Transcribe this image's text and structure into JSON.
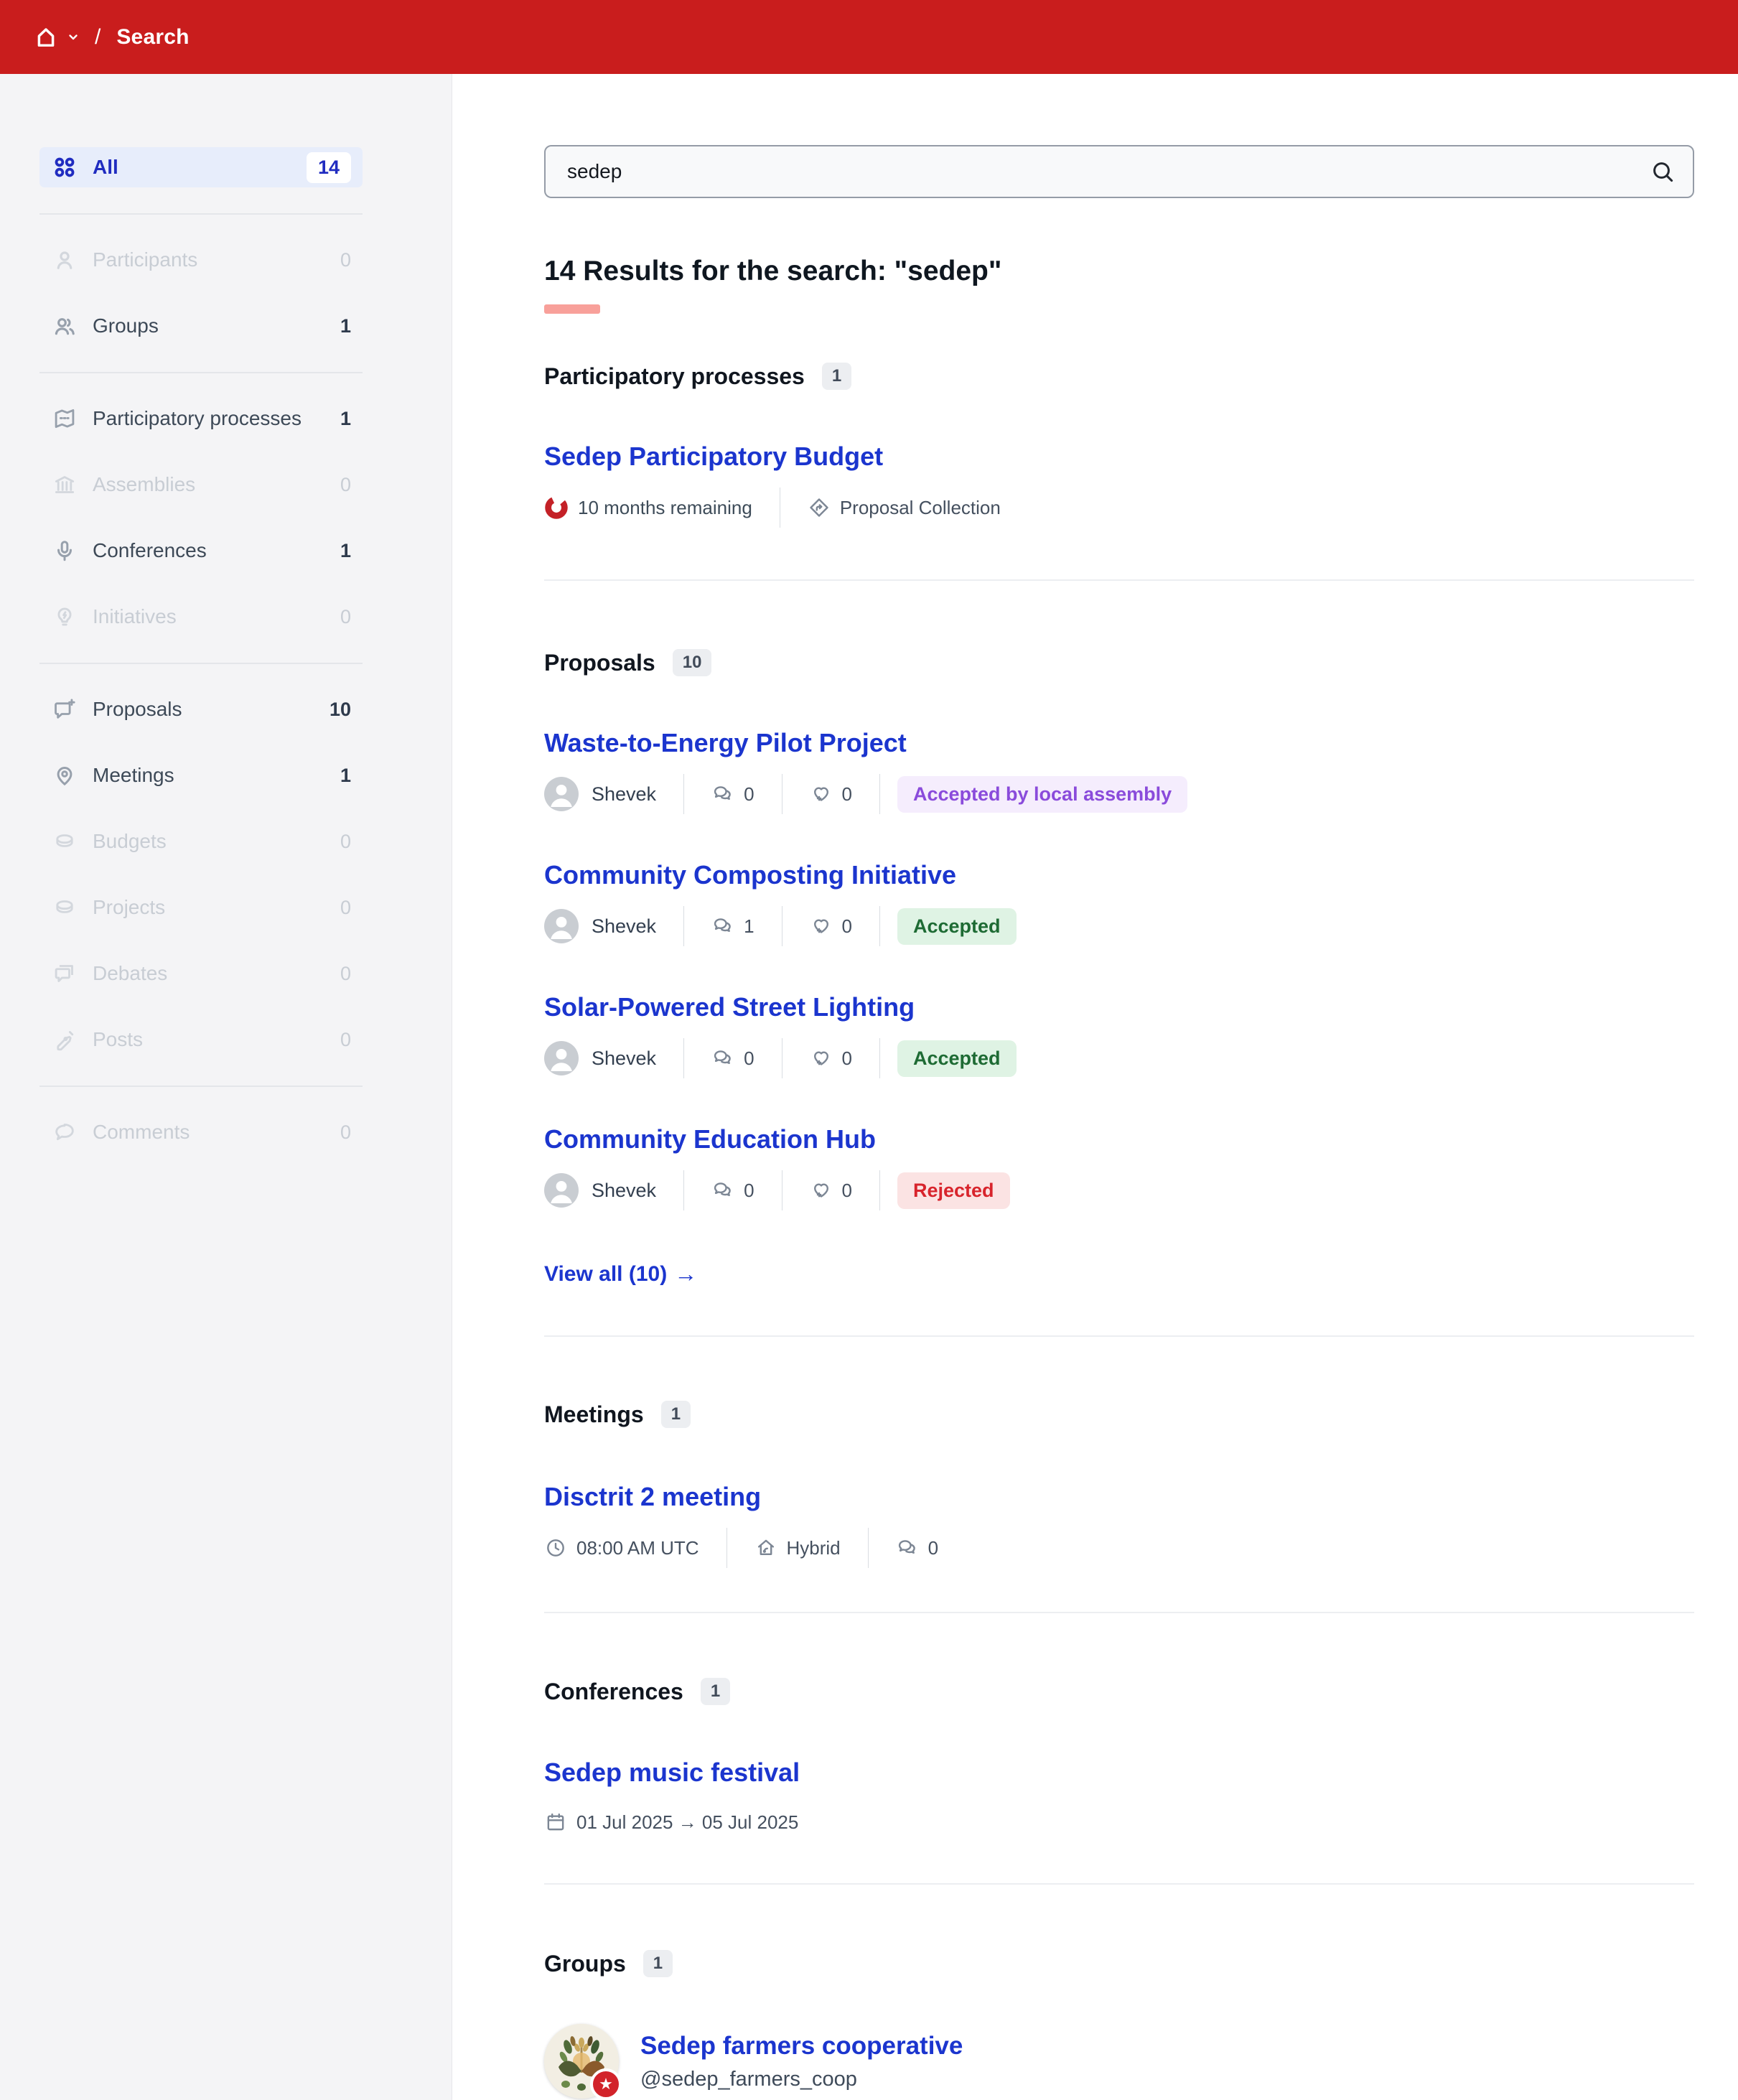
{
  "header": {
    "title": "Search",
    "separator": "/"
  },
  "search": {
    "value": "sedep"
  },
  "results_heading": "14 Results for the search: \"sedep\"",
  "sidebar": {
    "items": [
      {
        "label": "All",
        "count": "14"
      },
      {
        "label": "Participants",
        "count": "0"
      },
      {
        "label": "Groups",
        "count": "1"
      },
      {
        "label": "Participatory processes",
        "count": "1"
      },
      {
        "label": "Assemblies",
        "count": "0"
      },
      {
        "label": "Conferences",
        "count": "1"
      },
      {
        "label": "Initiatives",
        "count": "0"
      },
      {
        "label": "Proposals",
        "count": "10"
      },
      {
        "label": "Meetings",
        "count": "1"
      },
      {
        "label": "Budgets",
        "count": "0"
      },
      {
        "label": "Projects",
        "count": "0"
      },
      {
        "label": "Debates",
        "count": "0"
      },
      {
        "label": "Posts",
        "count": "0"
      },
      {
        "label": "Comments",
        "count": "0"
      }
    ]
  },
  "sections": {
    "processes": {
      "title": "Participatory processes",
      "count": "1",
      "item": {
        "title": "Sedep Participatory Budget",
        "remaining": "10 months remaining",
        "component": "Proposal Collection"
      }
    },
    "proposals": {
      "title": "Proposals",
      "count": "10",
      "items": [
        {
          "title": "Waste-to-Energy Pilot Project",
          "author": "Shevek",
          "comments": "0",
          "endorsements": "0",
          "status": "Accepted by local assembly",
          "status_variant": "status-purple"
        },
        {
          "title": "Community Composting Initiative",
          "author": "Shevek",
          "comments": "1",
          "endorsements": "0",
          "status": "Accepted",
          "status_variant": "status-green"
        },
        {
          "title": "Solar-Powered Street Lighting",
          "author": "Shevek",
          "comments": "0",
          "endorsements": "0",
          "status": "Accepted",
          "status_variant": "status-green"
        },
        {
          "title": "Community Education Hub",
          "author": "Shevek",
          "comments": "0",
          "endorsements": "0",
          "status": "Rejected",
          "status_variant": "status-red"
        }
      ],
      "view_all": "View all (10)"
    },
    "meetings": {
      "title": "Meetings",
      "count": "1",
      "item": {
        "title": "Disctrit 2 meeting",
        "time": "08:00 AM UTC",
        "mode": "Hybrid",
        "comments": "0"
      }
    },
    "conferences": {
      "title": "Conferences",
      "count": "1",
      "item": {
        "title": "Sedep music festival",
        "dates": "01 Jul 2025 → 05 Jul 2025"
      }
    },
    "groups": {
      "title": "Groups",
      "count": "1",
      "item": {
        "name": "Sedep farmers cooperative",
        "handle": "@sedep_farmers_coop"
      }
    }
  },
  "glyphs": {
    "arrow_right": "→",
    "star": "★"
  },
  "colors": {
    "header_red": "#C91D1D",
    "link_blue": "#1B35CE",
    "sidebar_active_blue": "#202CC0",
    "heading_underline": "#F8A09A",
    "badge_purple_bg": "#F5EDFD",
    "badge_purple_text": "#8A4BDB",
    "badge_green_bg": "#DFF3E4",
    "badge_green_text": "#1E6B34",
    "badge_red_bg": "#FBE3E3",
    "badge_red_text": "#D8242C",
    "timer_red": "#C42127"
  }
}
